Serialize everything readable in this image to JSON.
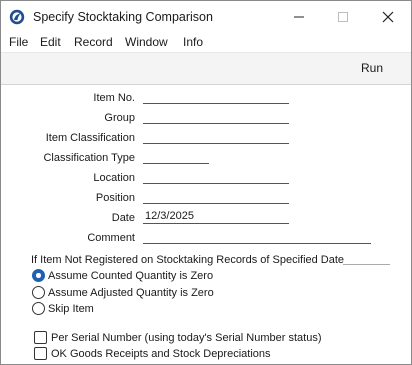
{
  "window": {
    "title": "Specify Stocktaking Comparison"
  },
  "menu": {
    "items": [
      "File",
      "Edit",
      "Record",
      "Window",
      "Info"
    ]
  },
  "toolbar": {
    "run_label": "Run"
  },
  "form": {
    "item_no_label": "Item No.",
    "item_no_value": "",
    "group_label": "Group",
    "group_value": "",
    "item_classification_label": "Item Classification",
    "item_classification_value": "",
    "classification_type_label": "Classification Type",
    "classification_type_value": "",
    "location_label": "Location",
    "location_value": "",
    "position_label": "Position",
    "position_value": "",
    "date_label": "Date",
    "date_value": "12/3/2025",
    "comment_label": "Comment",
    "comment_value": ""
  },
  "not_registered": {
    "heading": "If Item Not Registered on Stocktaking Records of Specified Date",
    "options": [
      {
        "label": "Assume Counted Quantity is Zero",
        "selected": true
      },
      {
        "label": "Assume Adjusted Quantity is Zero",
        "selected": false
      },
      {
        "label": "Skip Item",
        "selected": false
      }
    ]
  },
  "checkboxes": [
    {
      "label": "Per Serial Number (using today's Serial Number status)",
      "checked": false
    },
    {
      "label": "OK Goods Receipts and Stock Depreciations",
      "checked": false
    }
  ],
  "colors": {
    "accent": "#1f5fb4",
    "toolbar_bg": "#f4f4f4"
  }
}
